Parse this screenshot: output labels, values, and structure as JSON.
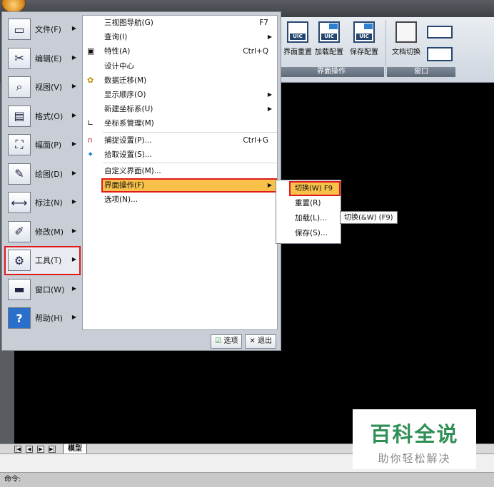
{
  "ribbon": {
    "buttons": [
      {
        "label": "界面重置",
        "icon": "uic-reset-icon"
      },
      {
        "label": "加载配置",
        "icon": "uic-load-icon"
      },
      {
        "label": "保存配置",
        "icon": "uic-save-icon"
      },
      {
        "label": "文档切换",
        "icon": "document-switch-icon"
      }
    ],
    "groups": {
      "interface_ops": "界面操作",
      "window": "窗口"
    },
    "uic": "UIC"
  },
  "left_menu": [
    {
      "label": "文件(F)",
      "icon": "file-icon"
    },
    {
      "label": "编辑(E)",
      "icon": "scissors-icon"
    },
    {
      "label": "视图(V)",
      "icon": "magnifier-icon"
    },
    {
      "label": "格式(O)",
      "icon": "format-icon"
    },
    {
      "label": "幅面(P)",
      "icon": "frame-icon"
    },
    {
      "label": "绘图(D)",
      "icon": "pencil-icon"
    },
    {
      "label": "标注(N)",
      "icon": "dimension-icon"
    },
    {
      "label": "修改(M)",
      "icon": "modify-icon"
    },
    {
      "label": "工具(T)",
      "icon": "gear-icon"
    },
    {
      "label": "窗口(W)",
      "icon": "window-icon"
    },
    {
      "label": "帮助(H)",
      "icon": "help-icon"
    }
  ],
  "tools_menu": [
    {
      "label": "三视图导航(G)",
      "shortcut": "F7"
    },
    {
      "label": "查询(I)",
      "submenu": true
    },
    {
      "label": "特性(A)",
      "shortcut": "Ctrl+Q",
      "icon": "properties-icon"
    },
    {
      "label": "设计中心"
    },
    {
      "label": "数据迁移(M)",
      "icon": "migrate-icon"
    },
    {
      "label": "显示顺序(O)",
      "submenu": true
    },
    {
      "label": "新建坐标系(U)",
      "submenu": true
    },
    {
      "label": "坐标系管理(M)",
      "icon": "ucs-icon"
    },
    {
      "label": "捕捉设置(P)...",
      "shortcut": "Ctrl+G",
      "icon": "magnet-icon"
    },
    {
      "label": "拾取设置(S)...",
      "icon": "pick-icon"
    },
    {
      "label": "自定义界面(M)..."
    },
    {
      "label": "界面操作(F)",
      "submenu": true,
      "active": true
    },
    {
      "label": "选项(N)..."
    }
  ],
  "submenu": [
    {
      "label": "切换(W) F9",
      "active": true
    },
    {
      "label": "重置(R)"
    },
    {
      "label": "加载(L)..."
    },
    {
      "label": "保存(S)..."
    }
  ],
  "tooltip": "切换(&W) (F9)",
  "bottom_buttons": {
    "options": "选项",
    "exit": "退出"
  },
  "tabs": {
    "model": "模型"
  },
  "command": {
    "prompt": "命令:"
  },
  "watermark": {
    "title": "百科全说",
    "subtitle": "助你轻松解决"
  }
}
